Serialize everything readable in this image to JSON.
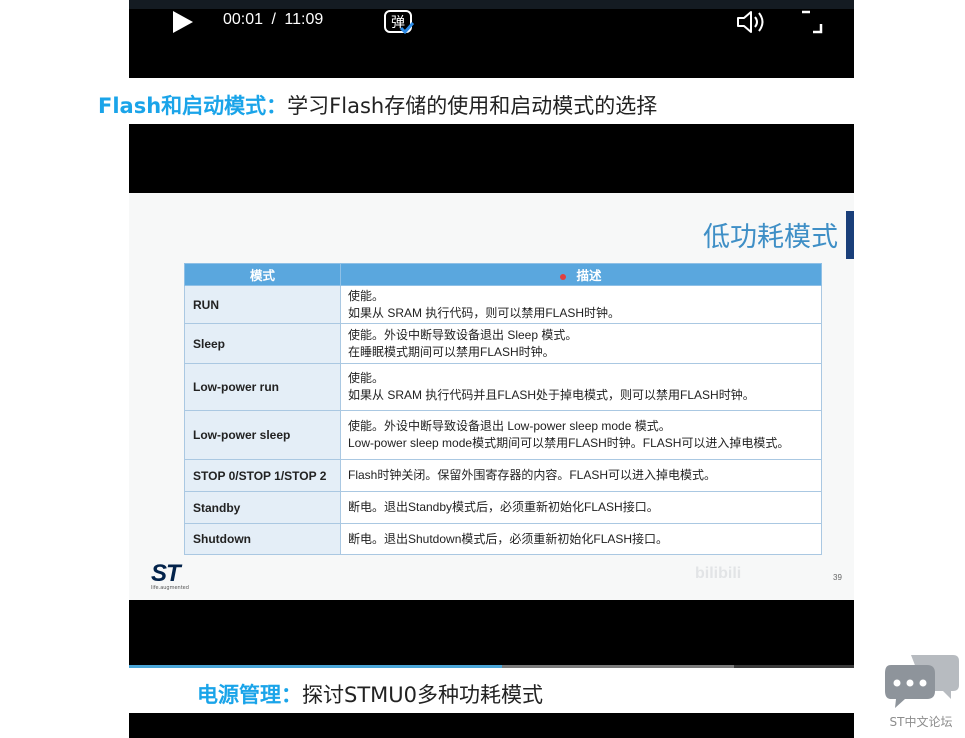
{
  "player_top": {
    "time_current": "00:01",
    "time_separator": "/",
    "time_total": "11:09",
    "danmu_glyph": "弹"
  },
  "section1": {
    "highlight": "Flash和启动模式：",
    "description": "学习Flash存储的使用和启动模式的选择"
  },
  "slide": {
    "heading": "低功耗模式",
    "table_headers": [
      "模式",
      "描述"
    ],
    "rows": [
      {
        "mode": "RUN",
        "desc": [
          "使能。",
          "如果从 SRAM 执行代码，则可以禁用FLASH时钟。"
        ]
      },
      {
        "mode": "Sleep",
        "desc": [
          "使能。外设中断导致设备退出 Sleep 模式。",
          "在睡眠模式期间可以禁用FLASH时钟。"
        ]
      },
      {
        "mode": "Low-power run",
        "desc": [
          "使能。",
          "如果从 SRAM 执行代码并且FLASH处于掉电模式，则可以禁用FLASH时钟。"
        ]
      },
      {
        "mode": "Low-power sleep",
        "desc": [
          "使能。外设中断导致设备退出 Low-power sleep mode 模式。",
          "Low-power sleep mode模式期间可以禁用FLASH时钟。FLASH可以进入掉电模式。"
        ]
      },
      {
        "mode": "STOP 0/STOP 1/STOP 2",
        "desc": [
          "Flash时钟关闭。保留外围寄存器的内容。FLASH可以进入掉电模式。"
        ]
      },
      {
        "mode": "Standby",
        "desc": [
          "断电。退出Standby模式后，必须重新初始化FLASH接口。"
        ]
      },
      {
        "mode": "Shutdown",
        "desc": [
          "断电。退出Shutdown模式后，必须重新初始化FLASH接口。"
        ]
      }
    ],
    "logo_text": "ST",
    "logo_tagline": "life.augmented",
    "watermark": "bilibili",
    "page_number": "39"
  },
  "progress": {
    "played_fraction": 0.005,
    "buffer_start": 0.515,
    "buffer_end": 0.835
  },
  "section2": {
    "highlight": "电源管理：",
    "description": "探讨STMU0多种功耗模式"
  },
  "chat_widget": {
    "label": "ST中文论坛",
    "icon": "chat-bubbles-icon"
  },
  "colors": {
    "accent": "#1aa4e9",
    "table_header": "#5aa7de",
    "slide_heading": "#3f8fc6"
  }
}
